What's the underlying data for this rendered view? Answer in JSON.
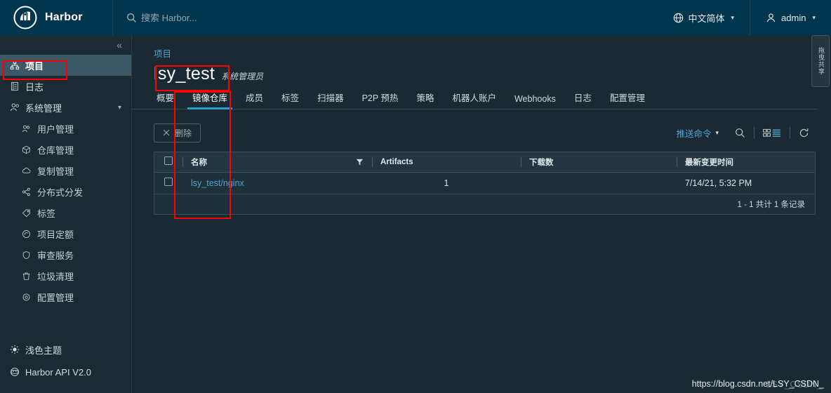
{
  "header": {
    "brand": "Harbor",
    "search_placeholder": "搜索 Harbor...",
    "search_value": "",
    "language": "中文简体",
    "user": "admin"
  },
  "sidebar": {
    "collapse_label": "«",
    "items": [
      {
        "label": "项目",
        "icon": "project-icon",
        "active": true,
        "sub": false
      },
      {
        "label": "日志",
        "icon": "log-icon",
        "active": false,
        "sub": false
      },
      {
        "label": "系统管理",
        "icon": "system-admin-icon",
        "active": false,
        "sub": false,
        "expandable": true
      },
      {
        "label": "用户管理",
        "icon": "users-icon",
        "active": false,
        "sub": true
      },
      {
        "label": "仓库管理",
        "icon": "registry-icon",
        "active": false,
        "sub": true
      },
      {
        "label": "复制管理",
        "icon": "replication-icon",
        "active": false,
        "sub": true
      },
      {
        "label": "分布式分发",
        "icon": "distribution-icon",
        "active": false,
        "sub": true
      },
      {
        "label": "标签",
        "icon": "label-icon",
        "active": false,
        "sub": true
      },
      {
        "label": "项目定额",
        "icon": "quota-icon",
        "active": false,
        "sub": true
      },
      {
        "label": "审查服务",
        "icon": "interrogation-icon",
        "active": false,
        "sub": true
      },
      {
        "label": "垃圾清理",
        "icon": "trash-icon",
        "active": false,
        "sub": true
      },
      {
        "label": "配置管理",
        "icon": "config-icon",
        "active": false,
        "sub": true
      }
    ],
    "bottom": [
      {
        "label": "浅色主题",
        "icon": "sun-icon"
      },
      {
        "label": "Harbor API V2.0",
        "icon": "api-icon"
      }
    ]
  },
  "main": {
    "breadcrumb": "项目",
    "project_title": "lsy_test",
    "project_role": "系统管理员",
    "tabs": [
      {
        "label": "概要",
        "active": false
      },
      {
        "label": "镜像仓库",
        "active": true
      },
      {
        "label": "成员",
        "active": false
      },
      {
        "label": "标签",
        "active": false
      },
      {
        "label": "扫描器",
        "active": false
      },
      {
        "label": "P2P 预热",
        "active": false
      },
      {
        "label": "策略",
        "active": false
      },
      {
        "label": "机器人账户",
        "active": false
      },
      {
        "label": "Webhooks",
        "active": false
      },
      {
        "label": "日志",
        "active": false
      },
      {
        "label": "配置管理",
        "active": false
      }
    ],
    "toolbar": {
      "delete_label": "删除",
      "push_command_label": "推送命令",
      "search_icon": "search-icon",
      "view_toggle_icon": "view-toggle-icon",
      "refresh_icon": "refresh-icon"
    },
    "table": {
      "columns": [
        "名称",
        "Artifacts",
        "下载数",
        "最新变更时间"
      ],
      "rows": [
        {
          "name": "lsy_test/nginx",
          "artifacts": "1",
          "downloads": "",
          "updated": "7/14/21, 5:32 PM"
        }
      ],
      "pagination": "1 - 1 共计 1 条记录"
    }
  },
  "side_tab": {
    "label": "拖曳共享"
  },
  "watermark": {
    "url": "https://blog.csdn.net/LSY_CSDN_",
    "ghost": "LSY_CSDN_"
  },
  "colors": {
    "header_bg": "#00364d",
    "sidebar_bg": "#1c2a33",
    "main_bg": "#1b2a32",
    "accent": "#2a9ccf",
    "link": "#4aa8d8",
    "annotation": "#ff0000"
  }
}
